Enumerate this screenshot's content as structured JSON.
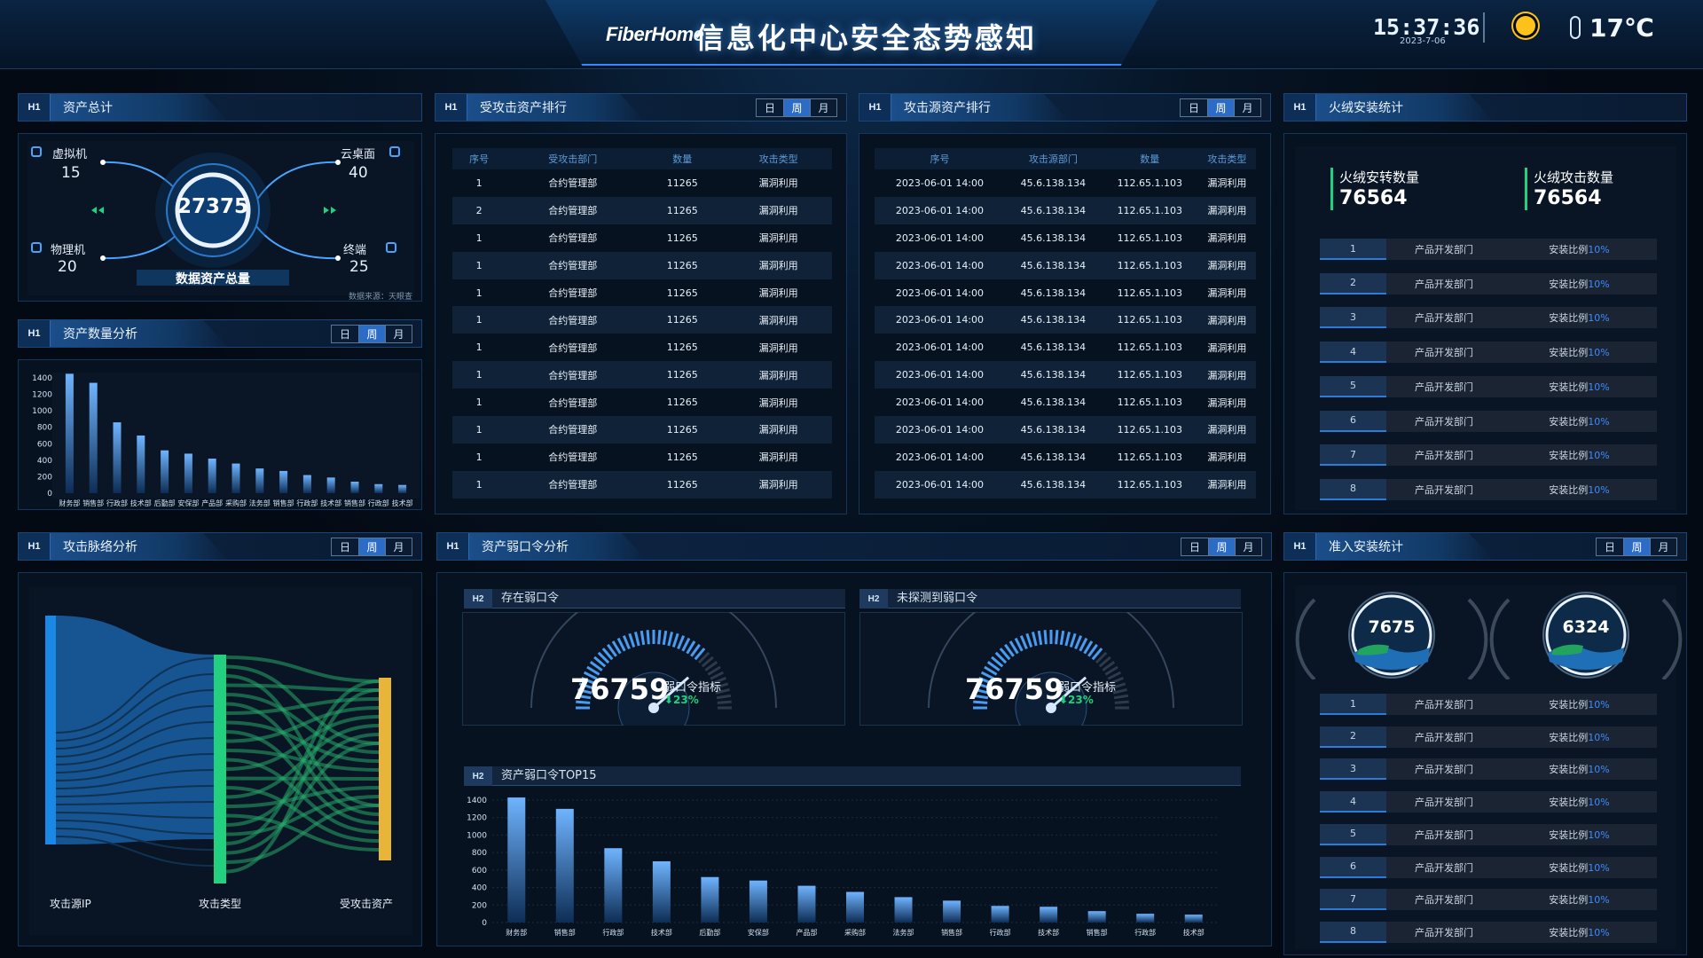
{
  "header": {
    "logo": "FiberHome",
    "title": "信息化中心安全态势感知",
    "time": "15:37:36",
    "date": "2023-7-06",
    "temperature": "17℃",
    "weather_icon": "sun-icon"
  },
  "periods": [
    "日",
    "周",
    "月"
  ],
  "asset_total": {
    "title": "资产总计",
    "total": "27375",
    "total_label": "数据资产总量",
    "source": "数据来源：天眼查",
    "items": [
      {
        "label": "虚拟机",
        "value": "15"
      },
      {
        "label": "云桌面",
        "value": "40"
      },
      {
        "label": "物理机",
        "value": "20"
      },
      {
        "label": "终端",
        "value": "25"
      }
    ]
  },
  "asset_count": {
    "title": "资产数量分析",
    "chart_data": {
      "type": "bar",
      "categories": [
        "财务部",
        "销售部",
        "行政部",
        "技术部",
        "后勤部",
        "安保部",
        "产品部",
        "采购部",
        "法务部",
        "销售部",
        "行政部",
        "技术部",
        "销售部",
        "行政部",
        "技术部"
      ],
      "values": [
        1450,
        1340,
        860,
        700,
        520,
        480,
        420,
        360,
        300,
        270,
        220,
        190,
        140,
        110,
        100
      ],
      "ylim": [
        0,
        1400
      ],
      "yticks": [
        0,
        200,
        400,
        600,
        800,
        1000,
        1200,
        1400
      ]
    }
  },
  "attacked_rank": {
    "title": "受攻击资产排行",
    "columns": [
      "序号",
      "受攻击部门",
      "数量",
      "攻击类型"
    ],
    "rows": [
      [
        "1",
        "合约管理部",
        "11265",
        "漏洞利用"
      ],
      [
        "2",
        "合约管理部",
        "11265",
        "漏洞利用"
      ],
      [
        "1",
        "合约管理部",
        "11265",
        "漏洞利用"
      ],
      [
        "1",
        "合约管理部",
        "11265",
        "漏洞利用"
      ],
      [
        "1",
        "合约管理部",
        "11265",
        "漏洞利用"
      ],
      [
        "1",
        "合约管理部",
        "11265",
        "漏洞利用"
      ],
      [
        "1",
        "合约管理部",
        "11265",
        "漏洞利用"
      ],
      [
        "1",
        "合约管理部",
        "11265",
        "漏洞利用"
      ],
      [
        "1",
        "合约管理部",
        "11265",
        "漏洞利用"
      ],
      [
        "1",
        "合约管理部",
        "11265",
        "漏洞利用"
      ],
      [
        "1",
        "合约管理部",
        "11265",
        "漏洞利用"
      ],
      [
        "1",
        "合约管理部",
        "11265",
        "漏洞利用"
      ]
    ]
  },
  "source_rank": {
    "title": "攻击源资产排行",
    "columns": [
      "序号",
      "攻击源部门",
      "数量",
      "攻击类型"
    ],
    "rows": [
      [
        "2023-06-01 14:00",
        "45.6.138.134",
        "112.65.1.103",
        "漏洞利用"
      ],
      [
        "2023-06-01 14:00",
        "45.6.138.134",
        "112.65.1.103",
        "漏洞利用"
      ],
      [
        "2023-06-01 14:00",
        "45.6.138.134",
        "112.65.1.103",
        "漏洞利用"
      ],
      [
        "2023-06-01 14:00",
        "45.6.138.134",
        "112.65.1.103",
        "漏洞利用"
      ],
      [
        "2023-06-01 14:00",
        "45.6.138.134",
        "112.65.1.103",
        "漏洞利用"
      ],
      [
        "2023-06-01 14:00",
        "45.6.138.134",
        "112.65.1.103",
        "漏洞利用"
      ],
      [
        "2023-06-01 14:00",
        "45.6.138.134",
        "112.65.1.103",
        "漏洞利用"
      ],
      [
        "2023-06-01 14:00",
        "45.6.138.134",
        "112.65.1.103",
        "漏洞利用"
      ],
      [
        "2023-06-01 14:00",
        "45.6.138.134",
        "112.65.1.103",
        "漏洞利用"
      ],
      [
        "2023-06-01 14:00",
        "45.6.138.134",
        "112.65.1.103",
        "漏洞利用"
      ],
      [
        "2023-06-01 14:00",
        "45.6.138.134",
        "112.65.1.103",
        "漏洞利用"
      ],
      [
        "2023-06-01 14:00",
        "45.6.138.134",
        "112.65.1.103",
        "漏洞利用"
      ]
    ]
  },
  "firewall": {
    "title": "火绒安装统计",
    "stat1_label": "火绒安转数量",
    "stat1_value": "76564",
    "stat2_label": "火绒攻击数量",
    "stat2_value": "76564",
    "rows": [
      {
        "n": "1",
        "dept": "产品开发部门",
        "ratio": "安装比例",
        "pct": "10%"
      },
      {
        "n": "2",
        "dept": "产品开发部门",
        "ratio": "安装比例",
        "pct": "10%"
      },
      {
        "n": "3",
        "dept": "产品开发部门",
        "ratio": "安装比例",
        "pct": "10%"
      },
      {
        "n": "4",
        "dept": "产品开发部门",
        "ratio": "安装比例",
        "pct": "10%"
      },
      {
        "n": "5",
        "dept": "产品开发部门",
        "ratio": "安装比例",
        "pct": "10%"
      },
      {
        "n": "6",
        "dept": "产品开发部门",
        "ratio": "安装比例",
        "pct": "10%"
      },
      {
        "n": "7",
        "dept": "产品开发部门",
        "ratio": "安装比例",
        "pct": "10%"
      },
      {
        "n": "8",
        "dept": "产品开发部门",
        "ratio": "安装比例",
        "pct": "10%"
      }
    ]
  },
  "attack_path": {
    "title": "攻击脉络分析",
    "labels": [
      "攻击源IP",
      "攻击类型",
      "受攻击资产"
    ]
  },
  "weak_pwd": {
    "title": "资产弱口令分析",
    "g1": {
      "title": "存在弱口令",
      "value": "76759",
      "label": "弱口令指标",
      "change": "23%"
    },
    "g2": {
      "title": "未探测到弱口令",
      "value": "76759",
      "label": "弱口令指标",
      "change": "23%"
    },
    "top_title": "资产弱口令TOP15",
    "chart_data": {
      "type": "bar",
      "categories": [
        "财务部",
        "销售部",
        "行政部",
        "技术部",
        "后勤部",
        "安保部",
        "产品部",
        "采购部",
        "法务部",
        "销售部",
        "行政部",
        "技术部",
        "销售部",
        "行政部",
        "技术部"
      ],
      "values": [
        1430,
        1300,
        850,
        700,
        520,
        480,
        420,
        350,
        290,
        250,
        190,
        180,
        130,
        100,
        90
      ],
      "ylim": [
        0,
        1400
      ],
      "yticks": [
        0,
        200,
        400,
        600,
        800,
        1000,
        1200,
        1400
      ]
    }
  },
  "access": {
    "title": "准入安装统计",
    "v1": "7675",
    "v2": "6324",
    "rows": [
      {
        "n": "1",
        "dept": "产品开发部门",
        "ratio": "安装比例",
        "pct": "10%"
      },
      {
        "n": "2",
        "dept": "产品开发部门",
        "ratio": "安装比例",
        "pct": "10%"
      },
      {
        "n": "3",
        "dept": "产品开发部门",
        "ratio": "安装比例",
        "pct": "10%"
      },
      {
        "n": "4",
        "dept": "产品开发部门",
        "ratio": "安装比例",
        "pct": "10%"
      },
      {
        "n": "5",
        "dept": "产品开发部门",
        "ratio": "安装比例",
        "pct": "10%"
      },
      {
        "n": "6",
        "dept": "产品开发部门",
        "ratio": "安装比例",
        "pct": "10%"
      },
      {
        "n": "7",
        "dept": "产品开发部门",
        "ratio": "安装比例",
        "pct": "10%"
      },
      {
        "n": "8",
        "dept": "产品开发部门",
        "ratio": "安装比例",
        "pct": "10%"
      }
    ]
  }
}
